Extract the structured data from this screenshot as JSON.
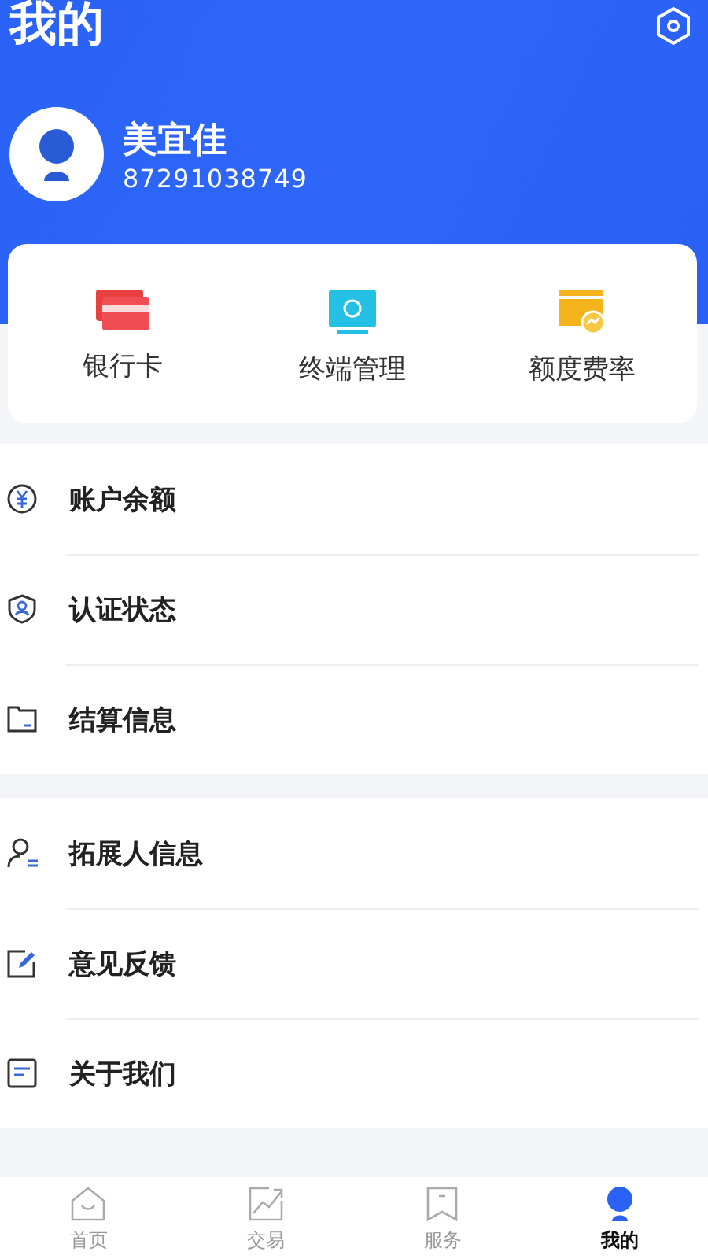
{
  "header": {
    "title": "我的"
  },
  "profile": {
    "name": "美宜佳",
    "account": "87291038749"
  },
  "shortcuts": [
    {
      "kind": "card",
      "label": "银行卡"
    },
    {
      "kind": "terminal",
      "label": "终端管理"
    },
    {
      "kind": "rate",
      "label": "额度费率"
    }
  ],
  "menu_groups": [
    [
      {
        "kind": "balance",
        "label": "账户余额"
      },
      {
        "kind": "verify",
        "label": "认证状态"
      },
      {
        "kind": "settle",
        "label": "结算信息"
      }
    ],
    [
      {
        "kind": "person",
        "label": "拓展人信息"
      },
      {
        "kind": "feedback",
        "label": "意见反馈"
      },
      {
        "kind": "about",
        "label": "关于我们"
      }
    ]
  ],
  "tabs": [
    {
      "kind": "home",
      "label": "首页",
      "selected": false
    },
    {
      "kind": "trade",
      "label": "交易",
      "selected": false
    },
    {
      "kind": "service",
      "label": "服务",
      "selected": false
    },
    {
      "kind": "mine",
      "label": "我的",
      "selected": true
    }
  ]
}
